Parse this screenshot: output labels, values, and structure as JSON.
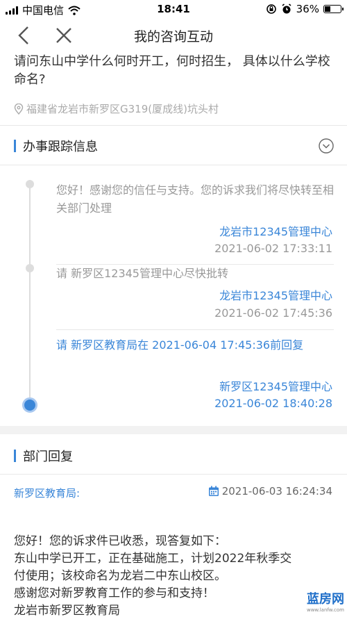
{
  "status_bar": {
    "carrier": "中国电信",
    "time": "18:41",
    "battery_text": "36%",
    "battery_level": 0.36
  },
  "nav": {
    "title": "我的咨询互动",
    "back_icon": "chevron-left-icon",
    "close_icon": "close-icon"
  },
  "question": {
    "text": "请问东山中学什么何时开工，何时招生， 具体以什么学校命名?",
    "location": "福建省龙岩市新罗区G319(厦成线)坑头村"
  },
  "tracking": {
    "heading": "办事跟踪信息",
    "entries": [
      {
        "text": "您好！感谢您的信任与支持。您的诉求我们将尽快转至相关部门处理",
        "org": "龙岩市12345管理中心",
        "time": "2021-06-02 17:33:11"
      },
      {
        "text": "请 新罗区12345管理中心尽快批转",
        "org": "龙岩市12345管理中心",
        "time": "2021-06-02 17:45:36"
      },
      {
        "text": "请 新罗区教育局在 2021-06-04 17:45:36前回复",
        "org": "新罗区12345管理中心",
        "time": "2021-06-02 18:40:28"
      }
    ]
  },
  "reply": {
    "heading": "部门回复",
    "org": "新罗区教育局:",
    "date": "2021-06-03 16:24:34",
    "lines": [
      "您好！您的诉求件已收悉，现答复如下：",
      "东山中学已开工，正在基础施工，计划2022年秋季交",
      "付使用；该校命名为龙岩二中东山校区。",
      "感谢您对新罗教育工作的参与和支持！",
      "龙岩市新罗区教育局"
    ]
  },
  "watermark": {
    "text": "蓝房网",
    "url": "www.lanfw.com"
  },
  "colors": {
    "accent": "#3a86d8",
    "muted": "#999999"
  }
}
